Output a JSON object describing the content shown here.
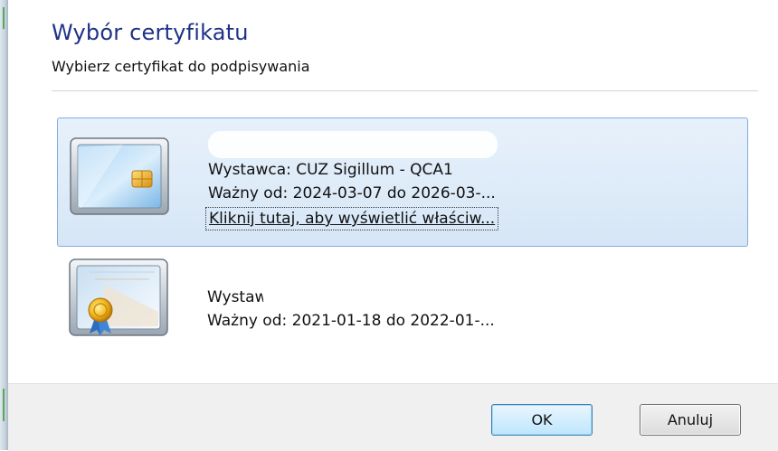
{
  "dialog": {
    "title": "Wybór certyfikatu",
    "subtitle": "Wybierz certyfikat do podpisywania"
  },
  "certificates": [
    {
      "name": "",
      "issuer": "Wystawca: CUZ Sigillum - QCA1",
      "validity": "Ważny od: 2024-03-07 do 2026-03-...",
      "details_link": "Kliknij tutaj, aby wyświetlić właściw...",
      "icon": "smart-card-icon",
      "selected": true
    },
    {
      "name": "",
      "issuer": "Wystaw",
      "validity": "Ważny od: 2021-01-18 do 2022-01-...",
      "icon": "certificate-icon",
      "selected": false
    }
  ],
  "buttons": {
    "ok": "OK",
    "cancel": "Anuluj"
  },
  "colors": {
    "title": "#1e3287",
    "selection_fill": "#dbe8f6",
    "selection_border": "#84acdd",
    "footer": "#f0f0f0"
  }
}
